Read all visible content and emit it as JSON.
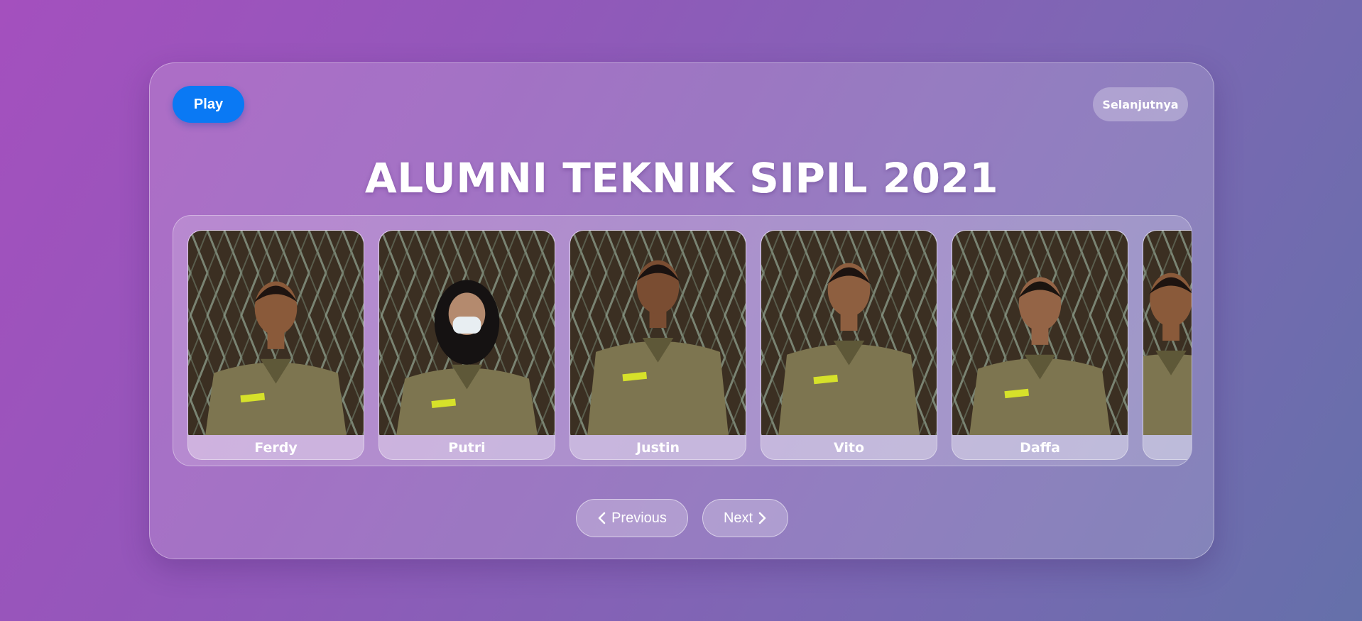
{
  "controls": {
    "play_label": "Play",
    "next_page_label": "Selanjutnya"
  },
  "title": "ALUMNI TEKNIK SIPIL 2021",
  "alumni": [
    {
      "name": "Ferdy"
    },
    {
      "name": "Putri"
    },
    {
      "name": "Justin"
    },
    {
      "name": "Vito"
    },
    {
      "name": "Daffa"
    },
    {
      "name": ""
    }
  ],
  "navigation": {
    "previous_label": "Previous",
    "next_label": "Next",
    "previous_icon": "chevron-left-icon",
    "next_icon": "chevron-right-icon"
  },
  "colors": {
    "play_button": "#0a79f4",
    "background_start": "#a450be",
    "background_end": "#6570aa",
    "uniform": "#7d7550"
  }
}
